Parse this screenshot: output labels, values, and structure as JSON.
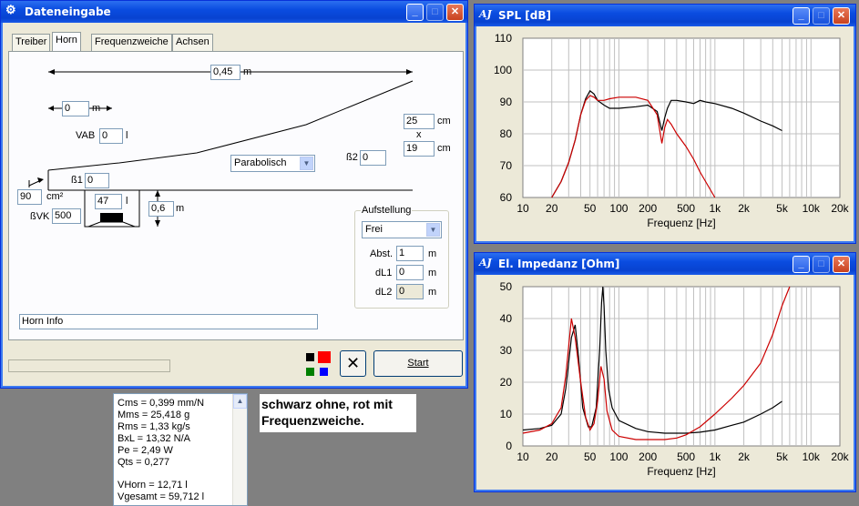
{
  "dateneingabe": {
    "title": "Dateneingabe",
    "tabs": [
      "Treiber",
      "Horn",
      "Frequenzweiche",
      "Achsen"
    ],
    "active_tab": "Horn",
    "horn_length": {
      "value": "0,45",
      "unit": "m"
    },
    "offset": {
      "value": "0",
      "unit": "m"
    },
    "vab": {
      "label": "VAB",
      "value": "0",
      "unit": "l"
    },
    "profile": "Parabolisch",
    "mouth_w": {
      "value": "25",
      "unit": "cm"
    },
    "times": "x",
    "mouth_h": {
      "value": "19",
      "unit": "cm"
    },
    "beta2": {
      "label": "ß2",
      "value": "0"
    },
    "beta1": {
      "label": "ß1",
      "value": "0"
    },
    "throat": {
      "value": "90",
      "unit": "cm²"
    },
    "vol": {
      "value": "47",
      "unit": "l"
    },
    "dist": {
      "value": "0,6",
      "unit": "m"
    },
    "bvk": {
      "label": "ßVK",
      "value": "500"
    },
    "aufstellung": {
      "title": "Aufstellung",
      "mode": "Frei",
      "abst": {
        "label": "Abst.",
        "value": "1",
        "unit": "m"
      },
      "dl1": {
        "label": "dL1",
        "value": "0",
        "unit": "m"
      },
      "dl2": {
        "label": "dL2",
        "value": "0",
        "unit": "m"
      }
    },
    "info": "Horn Info",
    "start_label": "Start",
    "colors": [
      "#000000",
      "#ff0000",
      "#008000",
      "#0000ff"
    ]
  },
  "params": {
    "lines": [
      "Cms = 0,399 mm/N",
      "Mms = 25,418 g",
      "Rms = 1,33 kg/s",
      "BxL = 13,32 N/A",
      "Pe = 2,49 W",
      "Qts = 0,277",
      "",
      "VHorn = 12,71 l",
      "Vgesamt = 59,712 l"
    ]
  },
  "note": {
    "line1": "schwarz ohne, rot mit",
    "line2": "Frequenzweiche."
  },
  "spl_window": {
    "title": "SPL [dB]",
    "logo": "AJ"
  },
  "imp_window": {
    "title": "El. Impedanz [Ohm]",
    "logo": "AJ"
  },
  "chart_data": [
    {
      "type": "line",
      "title": "SPL [dB]",
      "xlabel": "Frequenz [Hz]",
      "ylabel": "",
      "xscale": "log",
      "xlim": [
        10,
        20000
      ],
      "ylim": [
        60,
        110
      ],
      "xticks": [
        "10",
        "20",
        "50",
        "100",
        "200",
        "500",
        "1k",
        "2k",
        "5k",
        "10k",
        "20k"
      ],
      "yticks": [
        "60",
        "70",
        "80",
        "90",
        "100",
        "110"
      ],
      "grid": true,
      "series": [
        {
          "color": "#000000",
          "x": [
            20,
            25,
            30,
            35,
            40,
            45,
            50,
            55,
            60,
            70,
            80,
            100,
            150,
            200,
            250,
            280,
            300,
            320,
            350,
            400,
            500,
            600,
            700,
            800,
            1000,
            1500,
            2000,
            3000,
            4000,
            5000
          ],
          "y": [
            60,
            65,
            71,
            78,
            86,
            91,
            93.5,
            92.5,
            90.5,
            89,
            88,
            88,
            88.5,
            89,
            87,
            81,
            85,
            88,
            90.5,
            90.5,
            90,
            89.5,
            90.5,
            90,
            89.5,
            88,
            86.5,
            84,
            82.5,
            81
          ]
        },
        {
          "color": "#cc0000",
          "x": [
            20,
            25,
            30,
            35,
            40,
            45,
            50,
            55,
            60,
            70,
            80,
            100,
            150,
            200,
            250,
            280,
            300,
            320,
            350,
            400,
            500,
            600,
            700,
            800,
            1000
          ],
          "y": [
            60,
            65,
            71,
            78,
            86,
            90.5,
            92,
            91.5,
            90.5,
            90.5,
            91,
            91.5,
            91.5,
            90.5,
            86,
            77,
            82,
            84.5,
            83,
            80,
            76,
            72,
            68,
            65,
            60
          ]
        }
      ]
    },
    {
      "type": "line",
      "title": "El. Impedanz [Ohm]",
      "xlabel": "Frequenz [Hz]",
      "ylabel": "",
      "xscale": "log",
      "xlim": [
        10,
        20000
      ],
      "ylim": [
        0,
        50
      ],
      "xticks": [
        "10",
        "20",
        "50",
        "100",
        "200",
        "500",
        "1k",
        "2k",
        "5k",
        "10k",
        "20k"
      ],
      "yticks": [
        "0",
        "10",
        "20",
        "30",
        "40",
        "50"
      ],
      "grid": true,
      "series": [
        {
          "color": "#000000",
          "x": [
            10,
            15,
            20,
            25,
            28,
            32,
            35,
            38,
            42,
            48,
            52,
            58,
            63,
            66,
            68,
            70,
            73,
            78,
            85,
            100,
            150,
            200,
            300,
            500,
            700,
            1000,
            1500,
            2000,
            3000,
            4000,
            5000
          ],
          "y": [
            5,
            5.5,
            6.5,
            10,
            18,
            34,
            38,
            28,
            12,
            6,
            6,
            12,
            30,
            45,
            50,
            44,
            30,
            18,
            12,
            8,
            5.5,
            4.5,
            4,
            4,
            4.3,
            5,
            6.5,
            7.5,
            10,
            12,
            14
          ]
        },
        {
          "color": "#cc0000",
          "x": [
            10,
            15,
            20,
            25,
            28,
            32,
            35,
            40,
            45,
            50,
            55,
            60,
            65,
            70,
            75,
            85,
            100,
            150,
            200,
            300,
            400,
            500,
            700,
            1000,
            1500,
            2000,
            3000,
            4000,
            5000,
            6000
          ],
          "y": [
            4,
            5,
            7,
            12,
            22,
            40,
            34,
            20,
            9,
            5,
            7,
            14,
            25,
            21,
            11,
            5,
            3,
            2,
            2,
            2,
            2.5,
            3.5,
            6,
            10,
            15,
            19,
            26,
            35,
            44,
            50
          ]
        }
      ]
    }
  ]
}
